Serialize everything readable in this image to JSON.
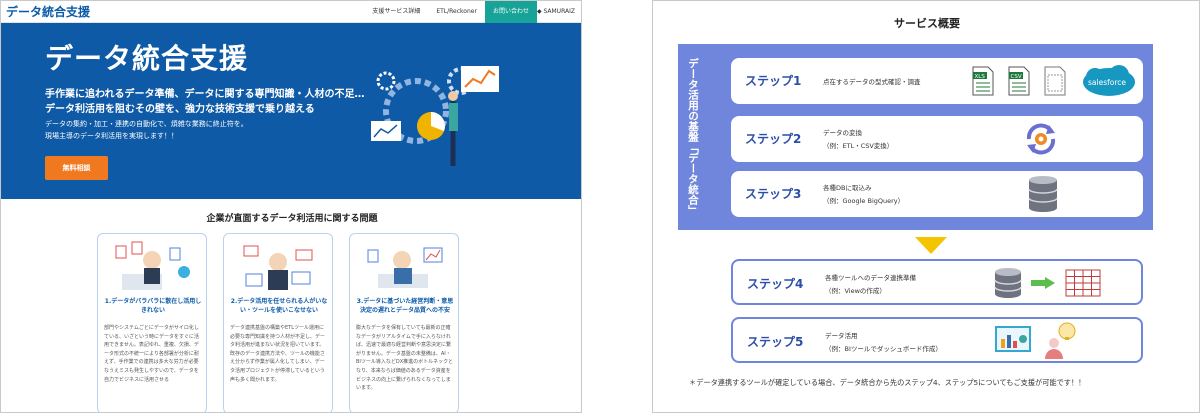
{
  "left": {
    "header": {
      "site_title": "データ統合支援",
      "nav": [
        "支援サービス詳細",
        "ETL/Reckoner",
        "お問い合わせ"
      ],
      "logo": "SAMURAIZ"
    },
    "hero": {
      "title": "データ統合支援",
      "line1": "手作業に追われるデータ準備、データに関する専門知識・人材の不足…",
      "line2": "データ利活用を阻むその壁を、強力な技術支援で乗り越える",
      "sub1": "データの集約・加工・連携の自動化で、煩雑な業務に終止符を。",
      "sub2": "現場主導のデータ利活用を実現します！！",
      "button": "無料相談",
      "colors": {
        "bg": "#0f5aa6",
        "button": "#f0781e"
      }
    },
    "problems": {
      "title": "企業が直面するデータ利活用に関する問題",
      "cards": [
        {
          "heading": "1.データがバラバラに散在し活用しきれない",
          "body": "部門やシステムごとにデータがサイロ化している、いざという時にデータをすぐに活用できません。表記ゆれ、重複、欠損、データ形式の不統一により各部署が分析に耐えず、手作業での連携は多大な労力が必要なうえミスも発生しやすいので、データを自力でビジネスに活用させる"
        },
        {
          "heading": "2.データ活用を任せられる人がいない・ツールを使いこなせない",
          "body": "データ連携基盤の構築やETLツール運用に必要な専門知識を持つ人材が不足し、データ利活用が進まない状況を招いています。既存のデータ連携方法や、ツールの機能さえ分からず作業が属人化してしまい、データ活用プロジェクトが停滞しているという声も多く聞かれます。"
        },
        {
          "heading": "3.データに基づいた経営判断・意思決定の遅れとデータ品質への不安",
          "body": "膨大なデータを保有していても最新の正確なデータがリアルタイムで手に入らなければ、迅速で最適な経営判断や意思決定に繋がりません。データ基盤の未整備は、AI・BIツール導入などDX推進のボトルネックとなり、本来ならば価値のあるデータ資産をビジネスの向上に繋げられなくなってしまいます。"
        }
      ]
    }
  },
  "right": {
    "title": "サービス概要",
    "vertical_label": "データ活用の基盤「データ統合」",
    "steps": [
      {
        "label": "ステップ1",
        "desc": [
          "点在するデータの型式確認・調査"
        ],
        "icons": [
          "xls-file-icon",
          "csv-file-icon",
          "document-icon",
          "salesforce-icon"
        ],
        "salesforce": "salesforce"
      },
      {
        "label": "ステップ2",
        "desc": [
          "データの変換",
          "（例：ETL・CSV変換）"
        ],
        "icons": [
          "gear-sync-icon"
        ]
      },
      {
        "label": "ステップ3",
        "desc": [
          "各種DBに取込み",
          "（例：Google BigQuery）"
        ],
        "icons": [
          "database-icon"
        ]
      },
      {
        "label": "ステップ4",
        "desc": [
          "各種ツールへのデータ連携準備",
          "（例：Viewの作成）"
        ],
        "icons": [
          "database-icon",
          "arrow-right-icon",
          "table-icon"
        ]
      },
      {
        "label": "ステップ5",
        "desc": [
          "データ活用",
          "（例：BIツールでダッシュボード作成）"
        ],
        "icons": [
          "bi-dashboard-icon",
          "idea-person-icon"
        ]
      }
    ],
    "footnote": "＊データ連携するツールが確定している場合、データ統合から先のステップ4、ステップ5についてもご支援が可能です！！",
    "colors": {
      "base": "#6f86dc",
      "step_text": "#2b4fa8",
      "arrow": "#f5c400"
    }
  }
}
